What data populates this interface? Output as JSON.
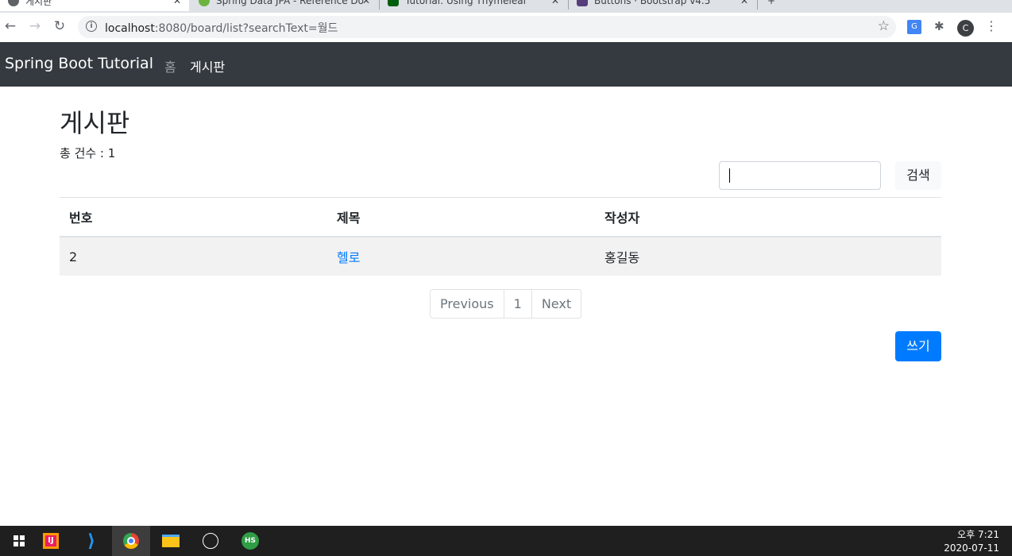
{
  "browser": {
    "tabs": [
      {
        "title": "게시판",
        "active": true
      },
      {
        "title": "Spring Data JPA - Reference Do",
        "active": false
      },
      {
        "title": "Tutorial: Using Thymeleaf",
        "active": false
      },
      {
        "title": "Buttons · Bootstrap v4.5",
        "active": false
      }
    ],
    "url_host": "localhost",
    "url_path": ":8080/board/list?searchText=월드",
    "avatar_letter": "C"
  },
  "navbar": {
    "brand": "Spring Boot Tutorial",
    "home": "홈",
    "board": "게시판"
  },
  "page": {
    "title": "게시판",
    "total_label": "총 건수 : 1",
    "search": {
      "value": "",
      "button": "검색"
    },
    "table": {
      "headers": [
        "번호",
        "제목",
        "작성자"
      ],
      "rows": [
        {
          "id": "2",
          "title": "헬로",
          "author": "홍길동"
        }
      ]
    },
    "pagination": {
      "previous": "Previous",
      "page": "1",
      "next": "Next"
    },
    "write_button": "쓰기"
  },
  "taskbar": {
    "time": "오후 7:21",
    "date": "2020-07-11"
  },
  "colors": {
    "navbar_bg": "#343a40",
    "primary": "#007bff",
    "link": "#007bff"
  }
}
